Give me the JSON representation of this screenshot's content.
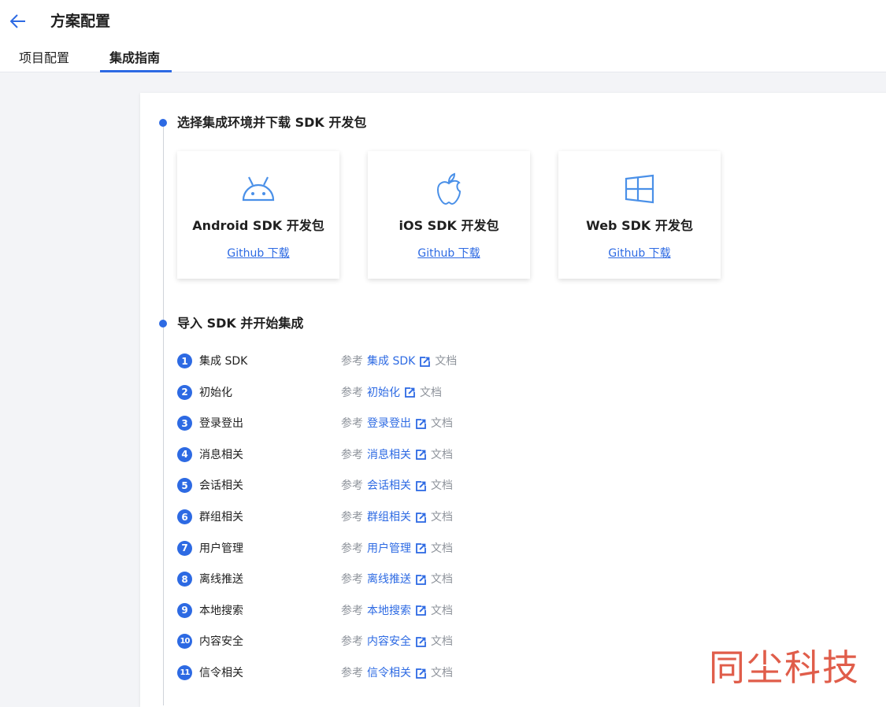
{
  "header": {
    "title": "方案配置",
    "tabs": [
      {
        "label": "项目配置"
      },
      {
        "label": "集成指南"
      }
    ]
  },
  "section1": {
    "title": "选择集成环境并下载 SDK 开发包",
    "cards": [
      {
        "name": "Android SDK 开发包",
        "link": "Github 下载",
        "icon": "android-icon"
      },
      {
        "name": "iOS SDK 开发包",
        "link": "Github 下载",
        "icon": "apple-icon"
      },
      {
        "name": "Web SDK 开发包",
        "link": "Github 下载",
        "icon": "windows-icon"
      }
    ]
  },
  "section2": {
    "title": "导入 SDK 并开始集成",
    "steps": [
      {
        "num": "1",
        "name": "集成 SDK",
        "prefix": "参考",
        "link": "集成 SDK",
        "suffix": "文档"
      },
      {
        "num": "2",
        "name": "初始化",
        "prefix": "参考",
        "link": "初始化",
        "suffix": "文档"
      },
      {
        "num": "3",
        "name": "登录登出",
        "prefix": "参考",
        "link": "登录登出",
        "suffix": "文档"
      },
      {
        "num": "4",
        "name": "消息相关",
        "prefix": "参考",
        "link": "消息相关",
        "suffix": "文档"
      },
      {
        "num": "5",
        "name": "会话相关",
        "prefix": "参考",
        "link": "会话相关",
        "suffix": "文档"
      },
      {
        "num": "6",
        "name": "群组相关",
        "prefix": "参考",
        "link": "群组相关",
        "suffix": "文档"
      },
      {
        "num": "7",
        "name": "用户管理",
        "prefix": "参考",
        "link": "用户管理",
        "suffix": "文档"
      },
      {
        "num": "8",
        "name": "离线推送",
        "prefix": "参考",
        "link": "离线推送",
        "suffix": "文档"
      },
      {
        "num": "9",
        "name": "本地搜索",
        "prefix": "参考",
        "link": "本地搜索",
        "suffix": "文档"
      },
      {
        "num": "10",
        "name": "内容安全",
        "prefix": "参考",
        "link": "内容安全",
        "suffix": "文档"
      },
      {
        "num": "11",
        "name": "信令相关",
        "prefix": "参考",
        "link": "信令相关",
        "suffix": "文档"
      }
    ]
  },
  "watermark": "同尘科技",
  "colors": {
    "accent": "#2d6ae3",
    "icon": "#4a90e8",
    "muted": "#8f949c",
    "watermark": "#e05d4a"
  }
}
